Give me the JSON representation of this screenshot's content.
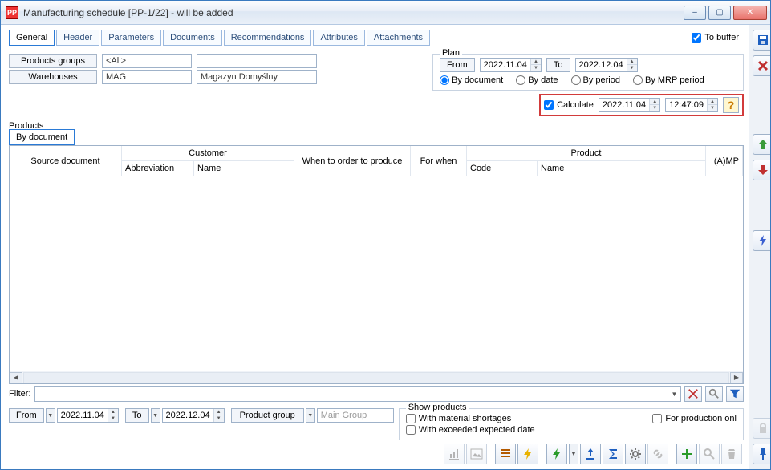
{
  "window": {
    "title": "Manufacturing schedule [PP-1/22] - will be added",
    "app_badge": "PP"
  },
  "win_buttons": {
    "min": "–",
    "max": "▢",
    "close": "✕"
  },
  "tabs": [
    "General",
    "Header",
    "Parameters",
    "Documents",
    "Recommendations",
    "Attributes",
    "Attachments"
  ],
  "to_buffer_label": "To buffer",
  "to_buffer_checked": true,
  "labels": {
    "products_groups": "Products groups",
    "warehouses": "Warehouses"
  },
  "fields": {
    "products_groups_value": "<All>",
    "warehouses_code": "MAG",
    "warehouses_name": "Magazyn Domyślny"
  },
  "plan": {
    "legend": "Plan",
    "from_label": "From",
    "from_value": "2022.11.04",
    "to_label": "To",
    "to_value": "2022.12.04",
    "radios": [
      "By document",
      "By date",
      "By period",
      "By MRP period"
    ],
    "selected_radio": 0
  },
  "calc": {
    "checked": true,
    "label": "Calculate",
    "date": "2022.11.04",
    "time": "12:47:09"
  },
  "products_label": "Products",
  "subtabs": [
    "By document"
  ],
  "grid": {
    "columns_top": [
      "Source document",
      "Customer",
      "When to order to produce",
      "For when",
      "Product",
      "(A)MP"
    ],
    "customer_sub": [
      "Abbreviation",
      "Name"
    ],
    "product_sub": [
      "Code",
      "Name"
    ]
  },
  "filter_label": "Filter:",
  "bottom": {
    "from_label": "From",
    "from_value": "2022.11.04",
    "to_label": "To",
    "to_value": "2022.12.04",
    "product_group_btn": "Product group",
    "product_group_placeholder": "Main Group"
  },
  "showprod": {
    "legend": "Show products",
    "chk1": "With material shortages",
    "chk2": "With exceeded expected date",
    "chk3": "For production onl"
  }
}
